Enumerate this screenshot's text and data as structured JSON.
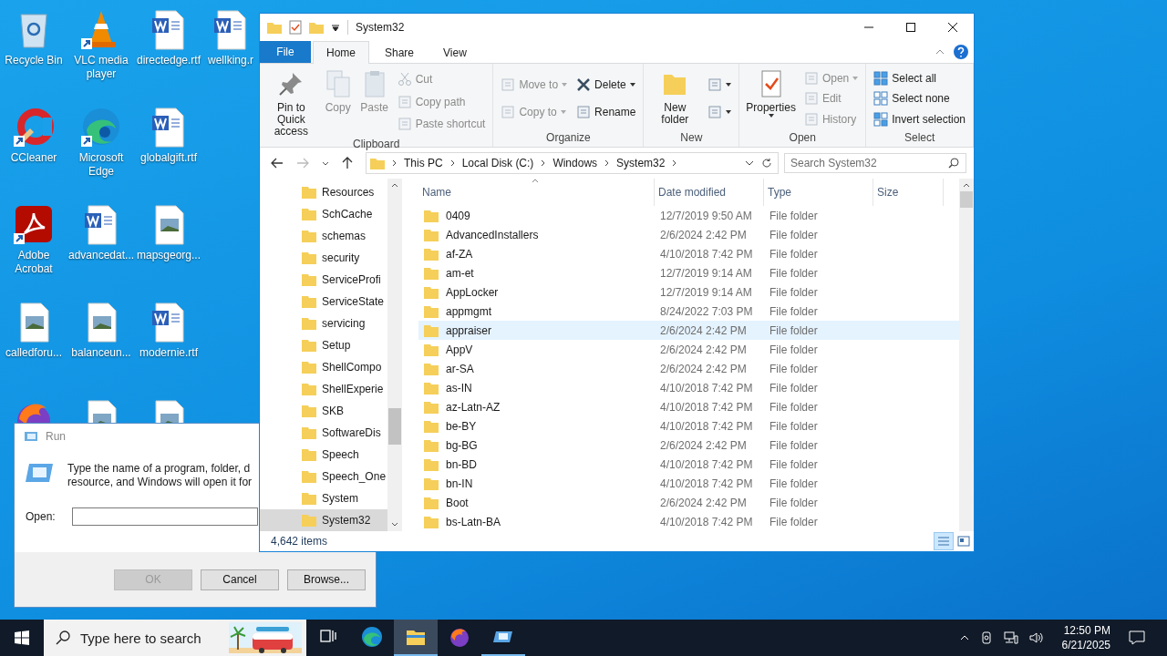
{
  "desktop": {
    "icons": [
      {
        "label": "Recycle Bin",
        "kind": "recycle",
        "shortcut": false
      },
      {
        "label": "VLC media player",
        "kind": "vlc",
        "shortcut": true
      },
      {
        "label": "directedge.rtf",
        "kind": "word",
        "shortcut": false
      },
      {
        "label": "wellking.r",
        "kind": "word",
        "shortcut": false
      },
      {
        "label": "CCleaner",
        "kind": "ccleaner",
        "shortcut": true
      },
      {
        "label": "Microsoft Edge",
        "kind": "edge",
        "shortcut": true
      },
      {
        "label": "globalgift.rtf",
        "kind": "word",
        "shortcut": false
      },
      {
        "kind": "blank"
      },
      {
        "label": "Adobe Acrobat",
        "kind": "acrobat",
        "shortcut": true
      },
      {
        "label": "advancedat...",
        "kind": "word",
        "shortcut": false
      },
      {
        "label": "mapsgeorg...",
        "kind": "image",
        "shortcut": false
      },
      {
        "kind": "blank"
      },
      {
        "label": "calledforu...",
        "kind": "image",
        "shortcut": false
      },
      {
        "label": "balanceun...",
        "kind": "image",
        "shortcut": false
      },
      {
        "label": "modernie.rtf",
        "kind": "word",
        "shortcut": false
      },
      {
        "kind": "blank"
      },
      {
        "kind": "firefox"
      },
      {
        "kind": "image"
      },
      {
        "kind": "image"
      }
    ]
  },
  "explorer": {
    "title": "System32",
    "file_tab": "File",
    "tabs": [
      {
        "label": "Home",
        "selected": true
      },
      {
        "label": "Share",
        "selected": false
      },
      {
        "label": "View",
        "selected": false
      }
    ],
    "ribbon": [
      {
        "name": "Clipboard",
        "items": [
          {
            "label": "Pin to Quick access",
            "kind": "pin",
            "disabled": false,
            "dropdown": false
          },
          {
            "label": "Copy",
            "kind": "copy",
            "disabled": true,
            "dropdown": false
          },
          {
            "label": "Paste",
            "kind": "paste",
            "disabled": true,
            "dropdown": false
          },
          {
            "items": [
              {
                "label": "Cut",
                "kind": "cut",
                "disabled": true,
                "dropdown": false
              },
              {
                "label": "Copy path",
                "kind": "path",
                "disabled": true,
                "dropdown": false
              },
              {
                "label": "Paste shortcut",
                "kind": "shortcut",
                "disabled": true,
                "dropdown": false
              }
            ]
          }
        ]
      },
      {
        "name": "Organize",
        "items": [
          {
            "items": [
              {
                "label": "Move to",
                "kind": "move",
                "disabled": true,
                "dropdown": true
              },
              {
                "label": "Copy to",
                "kind": "copyto",
                "disabled": true,
                "dropdown": true
              }
            ]
          },
          {
            "items": [
              {
                "label": "Delete",
                "kind": "delete",
                "disabled": false,
                "dropdown": true
              },
              {
                "label": "Rename",
                "kind": "rename",
                "disabled": false,
                "dropdown": false
              }
            ]
          }
        ]
      },
      {
        "name": "New",
        "items": [
          {
            "label": "New folder",
            "kind": "folder",
            "disabled": false,
            "dropdown": false
          },
          {
            "items": [
              {
                "kind": "newitem",
                "disabled": false,
                "dropdown": true
              },
              {
                "kind": "easyaccess",
                "disabled": false,
                "dropdown": true
              }
            ]
          }
        ]
      },
      {
        "name": "Open",
        "items": [
          {
            "label": "Properties",
            "kind": "properties",
            "disabled": false,
            "dropdown": true
          },
          {
            "items": [
              {
                "label": "Open",
                "kind": "open",
                "disabled": true,
                "dropdown": true
              },
              {
                "label": "Edit",
                "kind": "edit",
                "disabled": true,
                "dropdown": false
              },
              {
                "label": "History",
                "kind": "history",
                "disabled": true,
                "dropdown": false
              }
            ]
          }
        ]
      },
      {
        "name": "Select",
        "items": [
          {
            "items": [
              {
                "label": "Select all",
                "kind": "selall",
                "disabled": false,
                "dropdown": false
              },
              {
                "label": "Select none",
                "kind": "selnone",
                "disabled": false,
                "dropdown": false
              },
              {
                "label": "Invert selection",
                "kind": "selinv",
                "disabled": false,
                "dropdown": false
              }
            ]
          }
        ]
      }
    ],
    "path": [
      "This PC",
      "Local Disk (C:)",
      "Windows",
      "System32"
    ],
    "search": {
      "placeholder": "Search System32"
    },
    "tree": [
      {
        "label": "Resources",
        "selected": false
      },
      {
        "label": "SchCache",
        "selected": false
      },
      {
        "label": "schemas",
        "selected": false
      },
      {
        "label": "security",
        "selected": false
      },
      {
        "label": "ServiceProfi",
        "selected": false
      },
      {
        "label": "ServiceState",
        "selected": false
      },
      {
        "label": "servicing",
        "selected": false
      },
      {
        "label": "Setup",
        "selected": false
      },
      {
        "label": "ShellCompo",
        "selected": false
      },
      {
        "label": "ShellExperie",
        "selected": false
      },
      {
        "label": "SKB",
        "selected": false
      },
      {
        "label": "SoftwareDis",
        "selected": false
      },
      {
        "label": "Speech",
        "selected": false
      },
      {
        "label": "Speech_One",
        "selected": false
      },
      {
        "label": "System",
        "selected": false
      },
      {
        "label": "System32",
        "selected": true
      }
    ],
    "columns": [
      "Name",
      "Date modified",
      "Type",
      "Size"
    ],
    "rows": [
      {
        "name": "0409",
        "date": "12/7/2019 9:50 AM",
        "type": "File folder",
        "selected": false
      },
      {
        "name": "AdvancedInstallers",
        "date": "2/6/2024 2:42 PM",
        "type": "File folder",
        "selected": false
      },
      {
        "name": "af-ZA",
        "date": "4/10/2018 7:42 PM",
        "type": "File folder",
        "selected": false
      },
      {
        "name": "am-et",
        "date": "12/7/2019 9:14 AM",
        "type": "File folder",
        "selected": false
      },
      {
        "name": "AppLocker",
        "date": "12/7/2019 9:14 AM",
        "type": "File folder",
        "selected": false
      },
      {
        "name": "appmgmt",
        "date": "8/24/2022 7:03 PM",
        "type": "File folder",
        "selected": false
      },
      {
        "name": "appraiser",
        "date": "2/6/2024 2:42 PM",
        "type": "File folder",
        "selected": true
      },
      {
        "name": "AppV",
        "date": "2/6/2024 2:42 PM",
        "type": "File folder",
        "selected": false
      },
      {
        "name": "ar-SA",
        "date": "2/6/2024 2:42 PM",
        "type": "File folder",
        "selected": false
      },
      {
        "name": "as-IN",
        "date": "4/10/2018 7:42 PM",
        "type": "File folder",
        "selected": false
      },
      {
        "name": "az-Latn-AZ",
        "date": "4/10/2018 7:42 PM",
        "type": "File folder",
        "selected": false
      },
      {
        "name": "be-BY",
        "date": "4/10/2018 7:42 PM",
        "type": "File folder",
        "selected": false
      },
      {
        "name": "bg-BG",
        "date": "2/6/2024 2:42 PM",
        "type": "File folder",
        "selected": false
      },
      {
        "name": "bn-BD",
        "date": "4/10/2018 7:42 PM",
        "type": "File folder",
        "selected": false
      },
      {
        "name": "bn-IN",
        "date": "4/10/2018 7:42 PM",
        "type": "File folder",
        "selected": false
      },
      {
        "name": "Boot",
        "date": "2/6/2024 2:42 PM",
        "type": "File folder",
        "selected": false
      },
      {
        "name": "bs-Latn-BA",
        "date": "4/10/2018 7:42 PM",
        "type": "File folder",
        "selected": false
      }
    ],
    "status": "4,642 items",
    "views": [
      {
        "kind": "details",
        "selected": true
      },
      {
        "kind": "tiles",
        "selected": false
      }
    ]
  },
  "run": {
    "title": "Run",
    "message": "Type the name of a program, folder, d\nresource, and Windows will open it for",
    "open_label": "Open:",
    "buttons": [
      {
        "label": "OK",
        "disabled": true
      },
      {
        "label": "Cancel",
        "disabled": false
      },
      {
        "label": "Browse...",
        "disabled": false
      }
    ]
  },
  "taskbar": {
    "search_placeholder": "Type here to search",
    "apps": [
      {
        "kind": "taskview",
        "active": false,
        "running": false
      },
      {
        "kind": "edge",
        "active": false,
        "running": false
      },
      {
        "kind": "explorer",
        "active": true,
        "running": true
      },
      {
        "kind": "firefox",
        "active": false,
        "running": false
      },
      {
        "kind": "run",
        "active": false,
        "running": true
      }
    ],
    "time": "12:50 PM",
    "date": "6/21/2025"
  }
}
